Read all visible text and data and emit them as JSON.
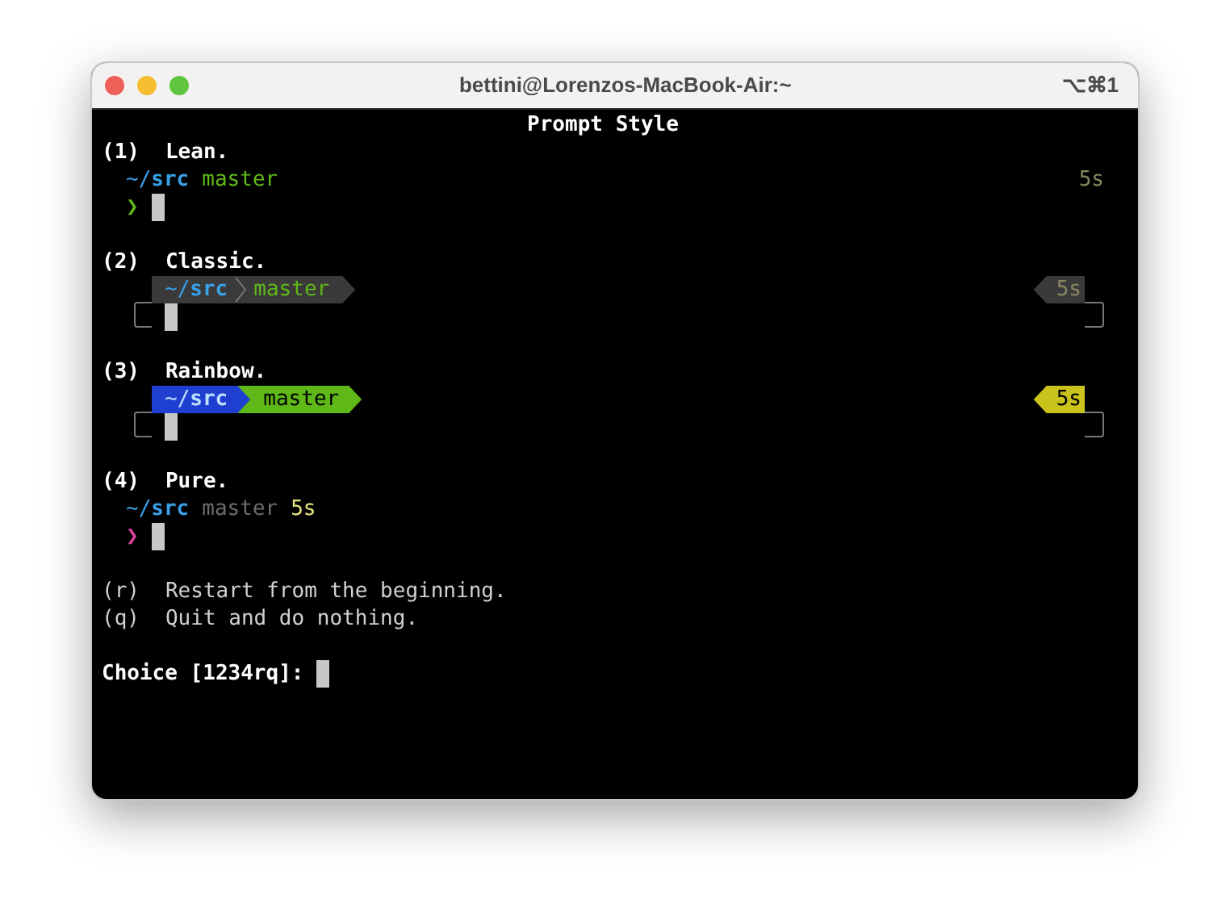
{
  "window": {
    "title": "bettini@Lorenzos-MacBook-Air:~",
    "shortcut": "⌥⌘1"
  },
  "heading": "Prompt Style",
  "styles": [
    {
      "kind": "lean",
      "number": "(1)",
      "name": "Lean.",
      "dir": "~/**src**",
      "branch": "master",
      "time": "5s",
      "prompt_char": "❯"
    },
    {
      "kind": "classic",
      "number": "(2)",
      "name": "Classic.",
      "dir": "~/**src**",
      "branch": "master",
      "time": "5s"
    },
    {
      "kind": "rainbow",
      "number": "(3)",
      "name": "Rainbow.",
      "dir": "~/**src**",
      "branch": "master",
      "time": "5s"
    },
    {
      "kind": "pure",
      "number": "(4)",
      "name": "Pure.",
      "dir": "~/**src**",
      "branch": "master",
      "time": "5s",
      "prompt_char": "❯"
    }
  ],
  "options": [
    {
      "key": "(r)",
      "text": "Restart from the beginning."
    },
    {
      "key": "(q)",
      "text": "Quit and do nothing."
    }
  ],
  "prompt": "Choice [1234rq]:"
}
